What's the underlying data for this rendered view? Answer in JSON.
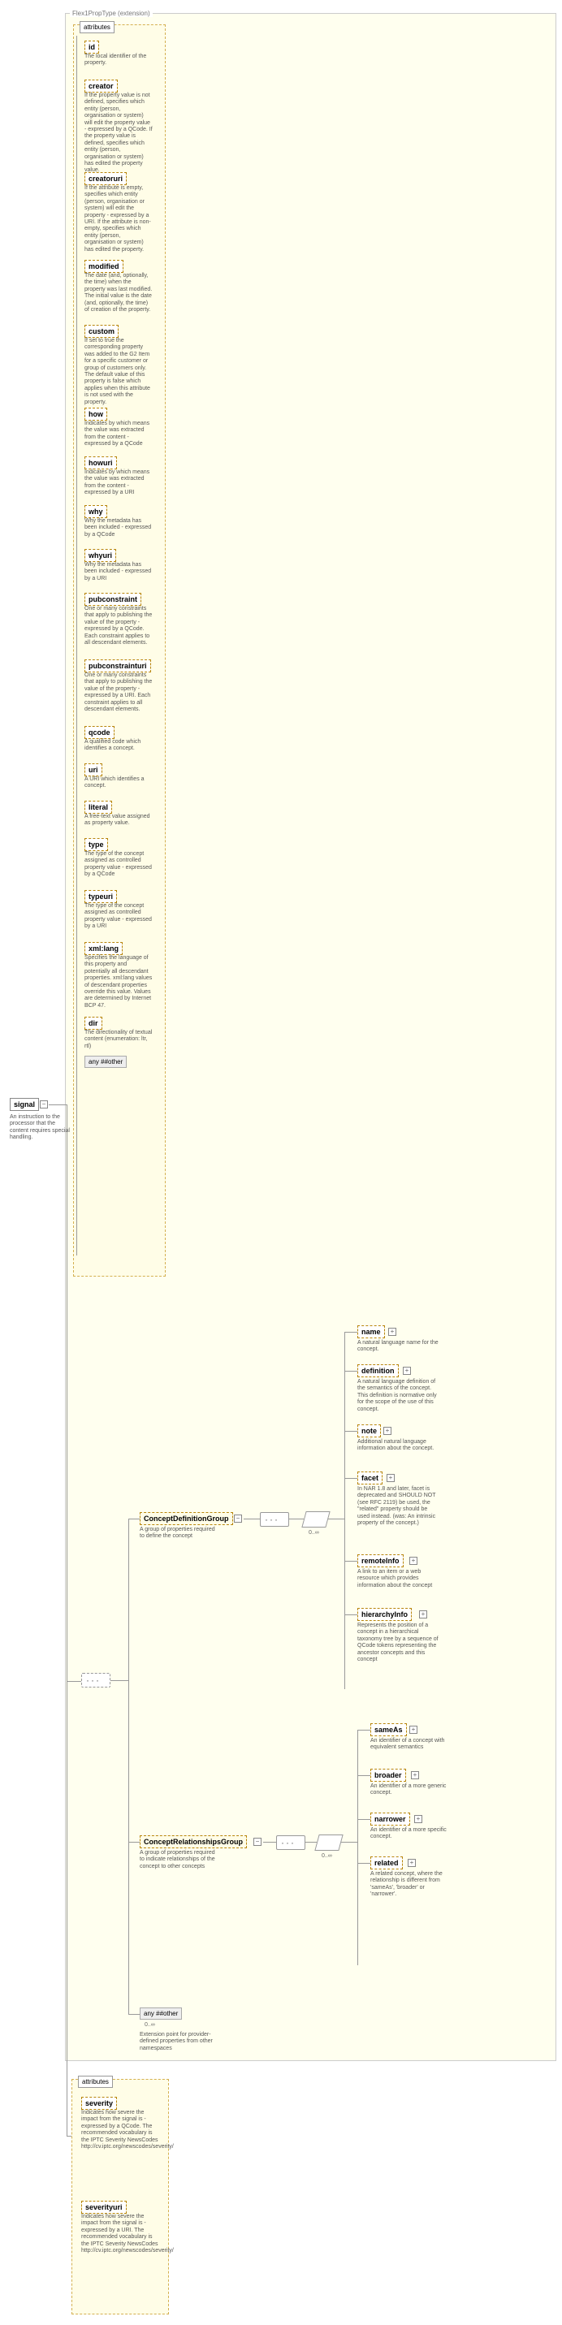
{
  "root": {
    "name": "signal",
    "desc": "An instruction to the processor that the content requires special handling."
  },
  "extension_label": "Flex1PropType (extension)",
  "attributes_label": "attributes",
  "attrs": [
    {
      "name": "id",
      "desc": "The local identifier of the property."
    },
    {
      "name": "creator",
      "desc": "If the property value is not defined, specifies which entity (person, organisation or system) will edit the property value - expressed by a QCode. If the property value is defined, specifies which entity (person, organisation or system) has edited the property value."
    },
    {
      "name": "creatoruri",
      "desc": "If the attribute is empty, specifies which entity (person, organisation or system) will edit the property - expressed by a URI. If the attribute is non-empty, specifies which entity (person, organisation or system) has edited the property."
    },
    {
      "name": "modified",
      "desc": "The date (and, optionally, the time) when the property was last modified. The initial value is the date (and, optionally, the time) of creation of the property."
    },
    {
      "name": "custom",
      "desc": "If set to true the corresponding property was added to the G2 Item for a specific customer or group of customers only. The default value of this property is false which applies when this attribute is not used with the property."
    },
    {
      "name": "how",
      "desc": "Indicates by which means the value was extracted from the content - expressed by a QCode"
    },
    {
      "name": "howuri",
      "desc": "Indicates by which means the value was extracted from the content - expressed by a URI"
    },
    {
      "name": "why",
      "desc": "Why the metadata has been included - expressed by a QCode"
    },
    {
      "name": "whyuri",
      "desc": "Why the metadata has been included - expressed by a URI"
    },
    {
      "name": "pubconstraint",
      "desc": "One or many constraints that apply to publishing the value of the property - expressed by a QCode. Each constraint applies to all descendant elements."
    },
    {
      "name": "pubconstrainturi",
      "desc": "One or many constraints that apply to publishing the value of the property - expressed by a URI. Each constraint applies to all descendant elements."
    },
    {
      "name": "qcode",
      "desc": "A qualified code which identifies a concept."
    },
    {
      "name": "uri",
      "desc": "A URI which identifies a concept."
    },
    {
      "name": "literal",
      "desc": "A free-text value assigned as property value."
    },
    {
      "name": "type",
      "desc": "The type of the concept assigned as controlled property value - expressed by a QCode"
    },
    {
      "name": "typeuri",
      "desc": "The type of the concept assigned as controlled property value - expressed by a URI"
    },
    {
      "name": "xml:lang",
      "desc": "Specifies the language of this property and potentially all descendant properties. xml:lang values of descendant properties override this value. Values are determined by Internet BCP 47."
    },
    {
      "name": "dir",
      "desc": "The directionality of textual content (enumeration: ltr, rtl)"
    }
  ],
  "any_other_attr": "any ##other",
  "groups": {
    "def": {
      "name": "ConceptDefinitionGroup",
      "desc": "A group of properties required to define the concept",
      "occ": "0..∞",
      "children": [
        {
          "name": "name",
          "desc": "A natural language name for the concept."
        },
        {
          "name": "definition",
          "desc": "A natural language definition of the semantics of the concept. This definition is normative only for the scope of the use of this concept."
        },
        {
          "name": "note",
          "desc": "Additional natural language information about the concept."
        },
        {
          "name": "facet",
          "desc": "In NAR 1.8 and later, facet is deprecated and SHOULD NOT (see RFC 2119) be used, the \"related\" property should be used instead. (was: An intrinsic property of the concept.)"
        },
        {
          "name": "remoteInfo",
          "desc": "A link to an item or a web resource which provides information about the concept"
        },
        {
          "name": "hierarchyInfo",
          "desc": "Represents the position of a concept in a hierarchical taxonomy tree by a sequence of QCode tokens representing the ancestor concepts and this concept"
        }
      ]
    },
    "rel": {
      "name": "ConceptRelationshipsGroup",
      "desc": "A group of properties required to indicate relationships of the concept to other concepts",
      "occ": "0..∞",
      "children": [
        {
          "name": "sameAs",
          "desc": "An identifier of a concept with equivalent semantics"
        },
        {
          "name": "broader",
          "desc": "An identifier of a more generic concept."
        },
        {
          "name": "narrower",
          "desc": "An identifier of a more specific concept."
        },
        {
          "name": "related",
          "desc": "A related concept, where the relationship is different from 'sameAs', 'broader' or 'narrower'."
        }
      ]
    }
  },
  "any_other_elem": {
    "label": "any ##other",
    "occ": "0..∞",
    "desc": "Extension point for provider-defined properties from other namespaces"
  },
  "sig_attrs_label": "attributes",
  "sig_attrs": [
    {
      "name": "severity",
      "desc": "Indicates how severe the impact from the signal is - expressed by a QCode. The recommended vocabulary is the IPTC Severity NewsCodes http://cv.iptc.org/newscodes/severity/"
    },
    {
      "name": "severityuri",
      "desc": "Indicates how severe the impact from the signal is - expressed by a URI. The recommended vocabulary is the IPTC Severity NewsCodes http://cv.iptc.org/newscodes/severity/"
    }
  ]
}
